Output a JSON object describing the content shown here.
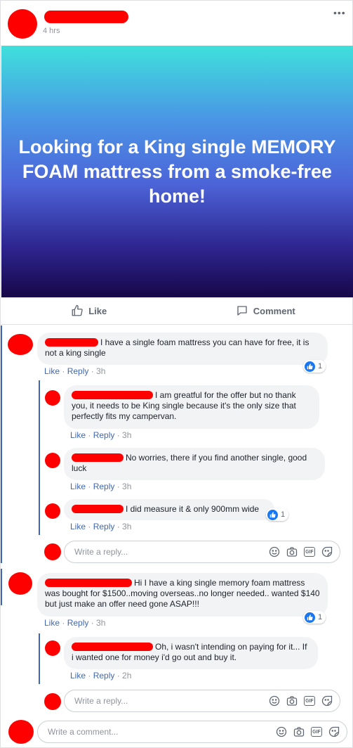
{
  "post": {
    "time": "4 hrs",
    "more": "•••",
    "banner_text": "Looking for a King single MEMORY FOAM mattress from a smoke-free home!",
    "banner_colors": [
      "#3fe0dc",
      "#4c64d8",
      "#170748"
    ]
  },
  "actions": {
    "like": "Like",
    "comment": "Comment"
  },
  "links": {
    "like": "Like",
    "reply": "Reply",
    "sep": " · "
  },
  "comments": [
    {
      "text": "I have a single foam mattress you can have for free, it is not a king single",
      "time": "3h",
      "reactions": "1",
      "replies": [
        {
          "text": "I am greatful for the offer but no thank you, it needs to be King single because it's the only size that perfectly fits my campervan.",
          "time": "3h"
        },
        {
          "text": "No worries, there if you find another single, good luck",
          "time": "3h"
        },
        {
          "text": "I did measure it & only 900mm wide",
          "time": "3h",
          "reactions": "1"
        }
      ]
    },
    {
      "text": "Hi I have a king single memory foam mattress was bought for $1500..moving overseas..no longer needed.. wanted $140 but just make an offer need gone ASAP!!!",
      "time": "3h",
      "reactions": "1",
      "replies": [
        {
          "text": "Oh, i wasn't intending on paying for it... If i wanted one for money i'd go out and buy it.",
          "time": "2h"
        }
      ]
    }
  ],
  "inputs": {
    "reply_placeholder": "Write a reply...",
    "comment_placeholder": "Write a comment..."
  },
  "colors": {
    "accent": "#4267b2",
    "like_blue": "#1877f2",
    "redaction": "#ff0000"
  }
}
